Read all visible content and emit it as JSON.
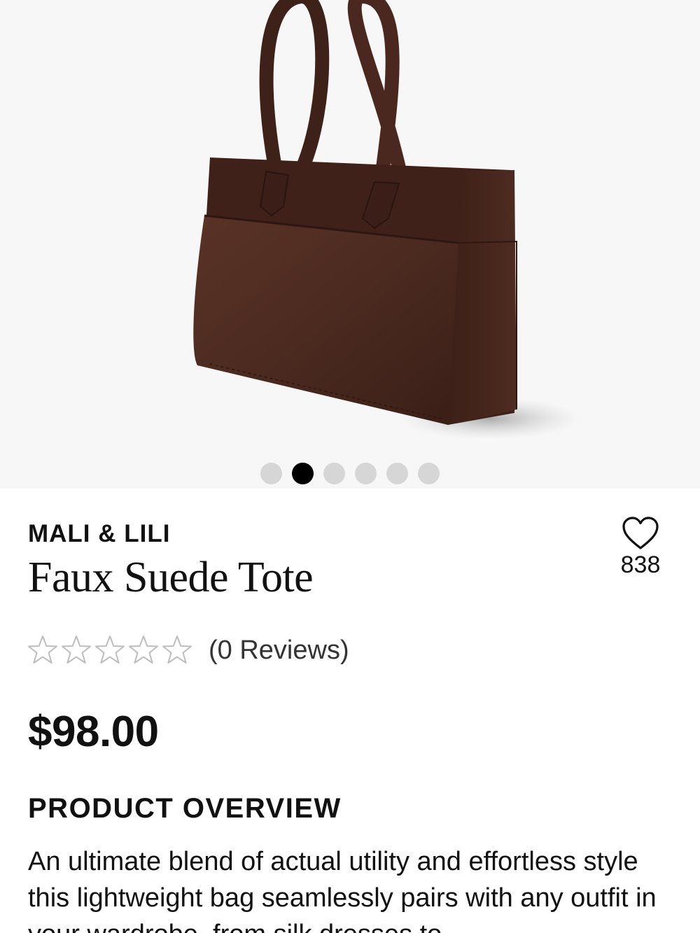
{
  "product": {
    "brand": "MALI & LILI",
    "name": "Faux Suede Tote",
    "price": "$98.00",
    "color": "#4a2a20"
  },
  "gallery": {
    "image_count": 6,
    "active_index": 1
  },
  "wishlist": {
    "icon": "heart-icon",
    "count": "838"
  },
  "rating": {
    "stars_filled": 0,
    "stars_total": 5,
    "reviews_label": "(0 Reviews)"
  },
  "overview": {
    "title": "PRODUCT OVERVIEW",
    "text": "An ultimate blend of actual utility and effortless style this lightweight bag seamlessly pairs with any outfit in your wardrobe, from silk dresses to"
  }
}
